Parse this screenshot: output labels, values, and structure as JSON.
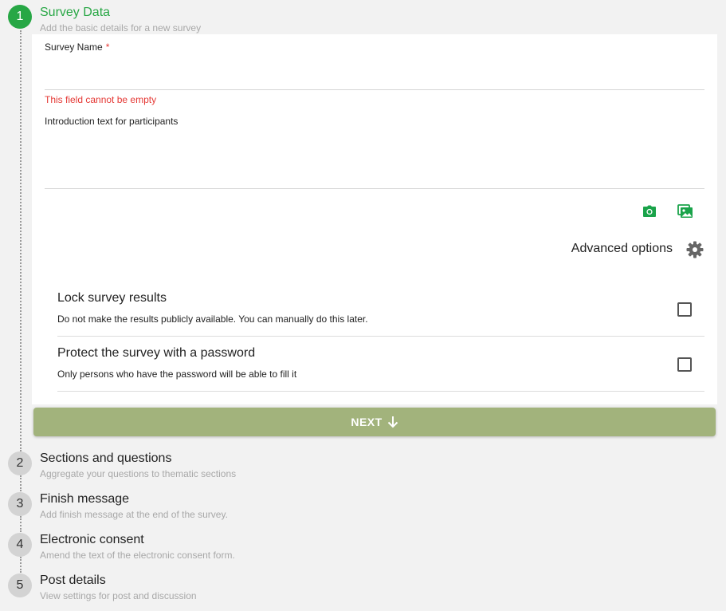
{
  "steps": [
    {
      "number": "1",
      "title": "Survey Data",
      "subtitle": "Add the basic details for a new survey"
    },
    {
      "number": "2",
      "title": "Sections and questions",
      "subtitle": "Aggregate your questions to thematic sections"
    },
    {
      "number": "3",
      "title": "Finish message",
      "subtitle": "Add finish message at the end of the survey."
    },
    {
      "number": "4",
      "title": "Electronic consent",
      "subtitle": "Amend the text of the electronic consent form."
    },
    {
      "number": "5",
      "title": "Post details",
      "subtitle": "View settings for post and discussion"
    }
  ],
  "form": {
    "survey_name_label": "Survey Name",
    "required_marker": "*",
    "survey_name_value": "",
    "survey_name_error": "This field cannot be empty",
    "intro_label": "Introduction text for participants",
    "intro_value": ""
  },
  "media": {
    "camera_icon": "camera-icon",
    "image_icon": "image-icon",
    "color": "#1aa34a"
  },
  "advanced": {
    "label": "Advanced options",
    "icon": "gear-icon"
  },
  "options": [
    {
      "title": "Lock survey results",
      "description": "Do not make the results publicly available. You can manually do this later.",
      "checked": false
    },
    {
      "title": "Protect the survey with a password",
      "description": "Only persons who have the password will be able to fill it",
      "checked": false
    }
  ],
  "next_button": {
    "label": "NEXT",
    "icon": "arrow-down-icon",
    "color": "#a2b37c"
  },
  "colors": {
    "active_step": "#28a745",
    "error": "#e53935"
  }
}
